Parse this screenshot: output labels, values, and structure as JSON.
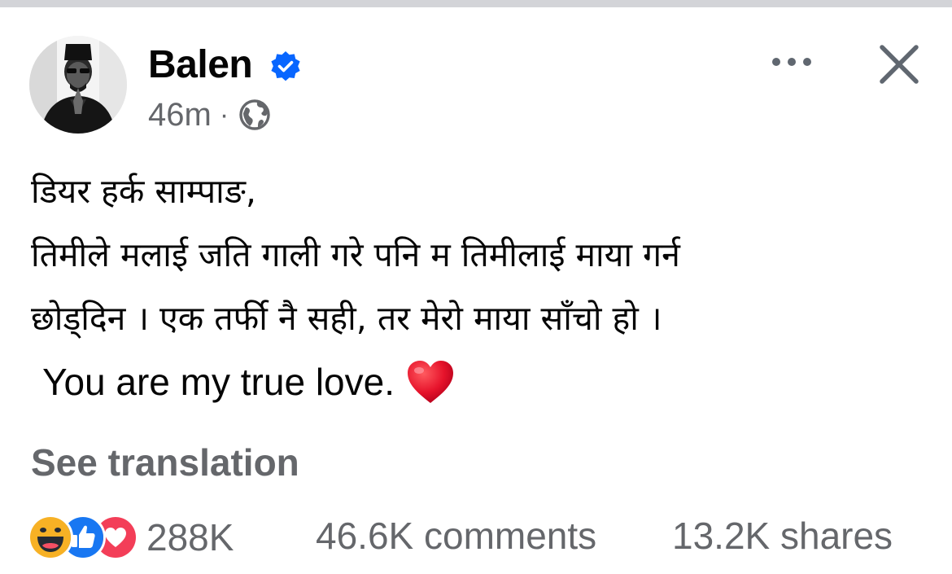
{
  "post": {
    "author": "Balen",
    "time": "46m",
    "separator": "·",
    "lines": [
      "डियर हर्क साम्पाङ,",
      "तिमीले मलाई जति गाली गरे पनि म तिमीलाई माया गर्न",
      "छोड्दिन । एक तर्फी नै सही, तर मेरो माया साँचो हो ।",
      "You are my true love."
    ],
    "see_translation": "See translation"
  },
  "engagement": {
    "reactions_count": "288K",
    "comments": "46.6K comments",
    "shares": "13.2K shares"
  },
  "icons": {
    "more": "more-horizontal-icon",
    "close": "close-icon",
    "verified": "verified-badge-icon",
    "audience": "globe-icon",
    "heart": "red-heart-emoji",
    "reactions": [
      "haha-icon",
      "like-icon",
      "love-icon"
    ]
  },
  "colors": {
    "verified": "#0866ff",
    "secondary_text": "#65676b",
    "like": "#1877f2",
    "love": "#f33e58",
    "haha": "#f7b125",
    "heart": "#e6132b"
  }
}
